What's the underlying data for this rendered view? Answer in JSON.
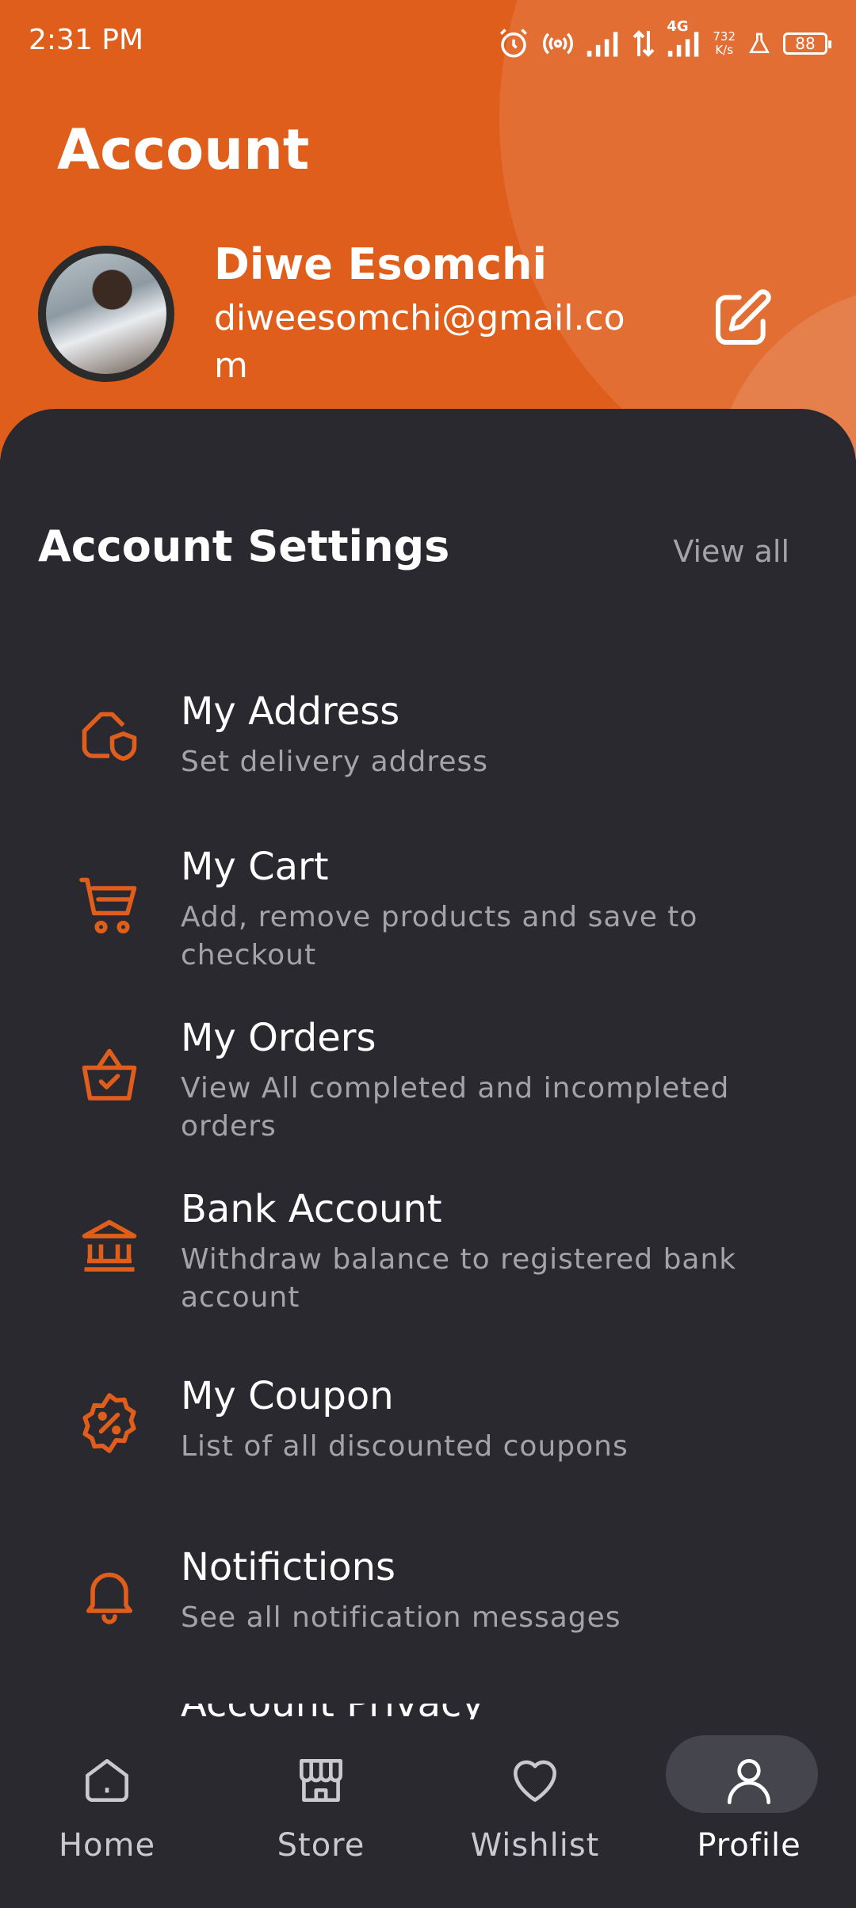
{
  "status_bar": {
    "time": "2:31 PM",
    "net_speed_value": "732",
    "net_speed_unit": "K/s",
    "network": "4G",
    "battery": "88"
  },
  "header": {
    "title": "Account",
    "user_name": "Diwe Esomchi",
    "user_email": "diweesomchi@gmail.com"
  },
  "settings": {
    "section_title": "Account Settings",
    "view_all": "View all",
    "items": [
      {
        "title": "My Address",
        "subtitle": "Set delivery address",
        "icon": "location-shield-icon"
      },
      {
        "title": "My Cart",
        "subtitle": "Add, remove products and save to checkout",
        "icon": "cart-icon"
      },
      {
        "title": "My Orders",
        "subtitle": "View All completed and incompleted orders",
        "icon": "basket-check-icon"
      },
      {
        "title": "Bank Account",
        "subtitle": "Withdraw balance to registered bank account",
        "icon": "bank-icon"
      },
      {
        "title": "My Coupon",
        "subtitle": "List of all discounted coupons",
        "icon": "coupon-icon"
      },
      {
        "title": "Notifictions",
        "subtitle": "See all notification messages",
        "icon": "bell-icon"
      },
      {
        "title": "Account Privacy",
        "subtitle": "",
        "icon": ""
      }
    ]
  },
  "bottom_nav": {
    "items": [
      {
        "label": "Home",
        "icon": "home-icon"
      },
      {
        "label": "Store",
        "icon": "store-icon"
      },
      {
        "label": "Wishlist",
        "icon": "heart-icon"
      },
      {
        "label": "Profile",
        "icon": "user-icon",
        "active": true
      }
    ]
  },
  "colors": {
    "accent": "#df5e1c",
    "background": "#2a2930",
    "muted_text": "#a3a3a8",
    "nav_active_pill": "#45454e"
  }
}
